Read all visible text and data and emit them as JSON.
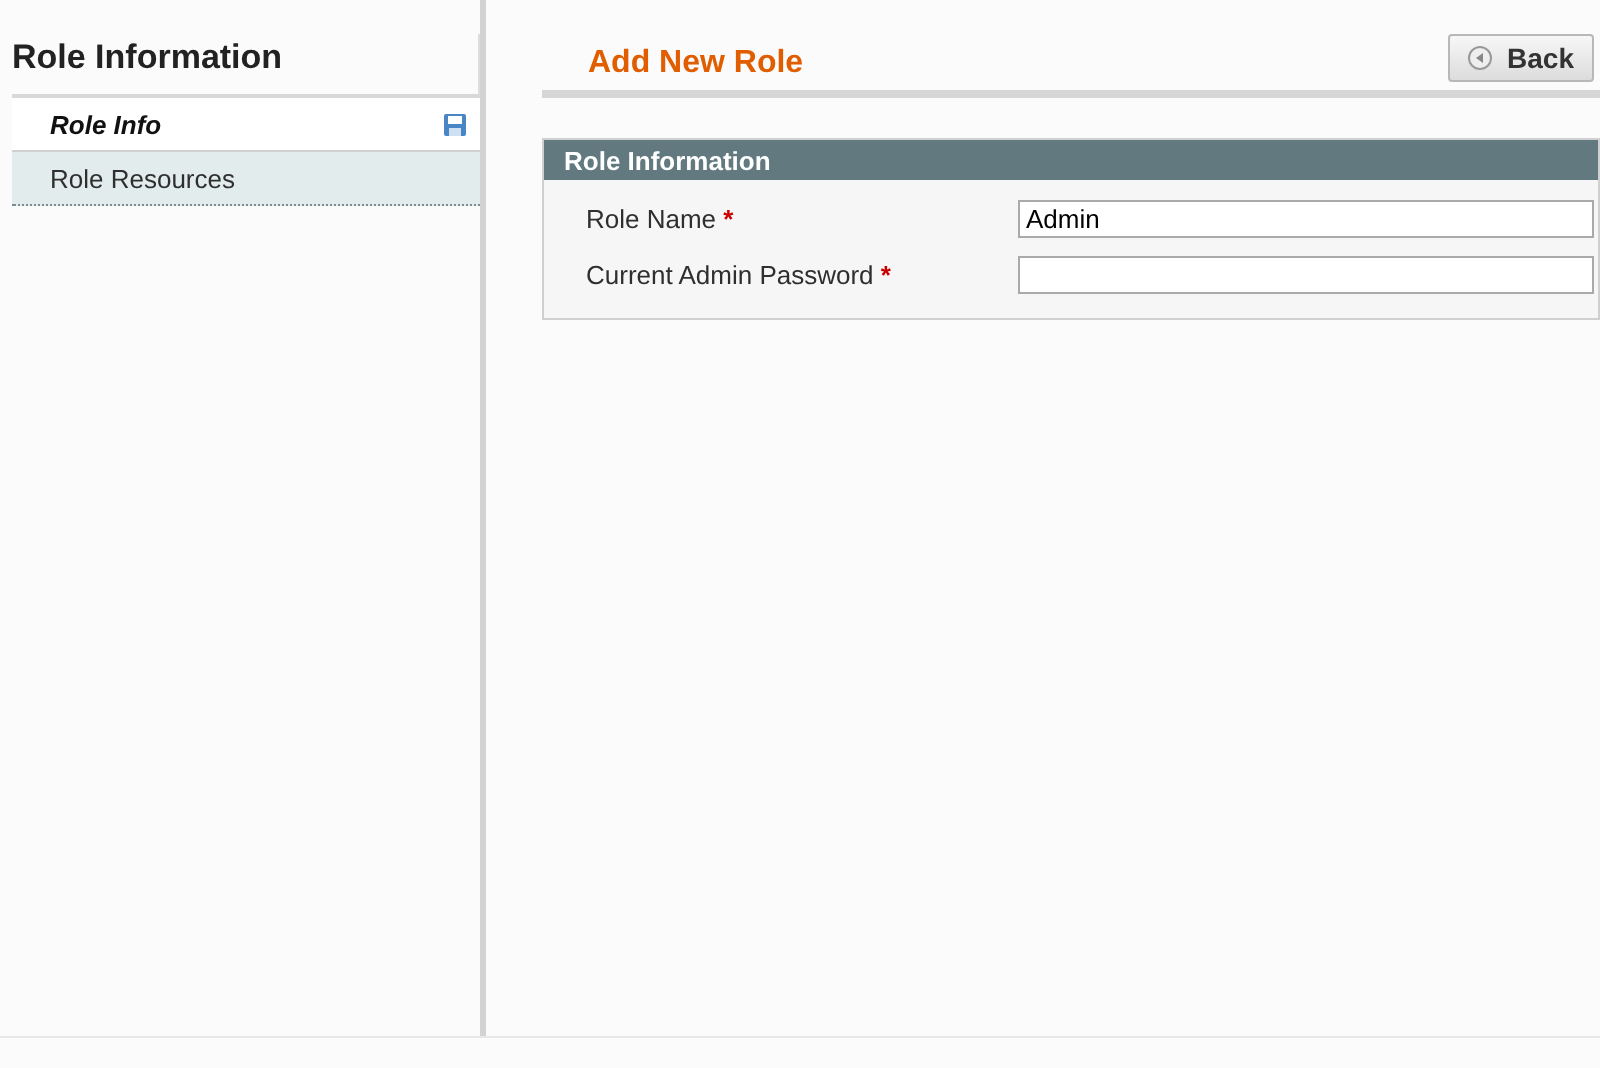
{
  "sidebar": {
    "title": "Role Information",
    "tabs": [
      {
        "label": "Role Info",
        "selected": true,
        "changed": true
      },
      {
        "label": "Role Resources",
        "selected": false,
        "changed": false
      }
    ]
  },
  "header": {
    "title": "Add New Role",
    "back_button": "Back"
  },
  "section": {
    "title": "Role Information",
    "fields": [
      {
        "label": "Role Name",
        "required_mark": "*",
        "value": "Admin"
      },
      {
        "label": "Current Admin Password",
        "required_mark": "*"
      }
    ]
  }
}
